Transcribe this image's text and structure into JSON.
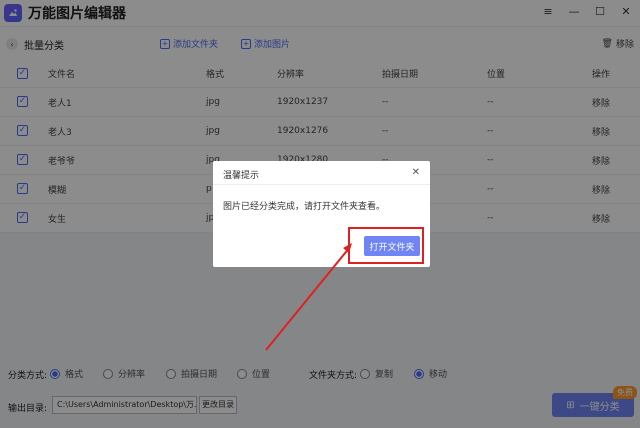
{
  "app": {
    "title": "万能图片编辑器"
  },
  "toolbar": {
    "page_title": "批量分类",
    "add_folder": "添加文件夹",
    "add_image": "添加图片",
    "remove": "移除"
  },
  "table": {
    "headers": [
      "文件名",
      "格式",
      "分辨率",
      "拍摄日期",
      "位置",
      "操作"
    ],
    "rows": [
      {
        "name": "老人1",
        "format": "jpg",
        "resolution": "1920x1237",
        "date": "--",
        "location": "--",
        "action": "移除"
      },
      {
        "name": "老人3",
        "format": "jpg",
        "resolution": "1920x1276",
        "date": "--",
        "location": "--",
        "action": "移除"
      },
      {
        "name": "老爷爷",
        "format": "jpg",
        "resolution": "1920x1280",
        "date": "--",
        "location": "--",
        "action": "移除"
      },
      {
        "name": "模糊",
        "format": "p",
        "resolution": "",
        "date": "--",
        "location": "--",
        "action": "移除"
      },
      {
        "name": "女生",
        "format": "jp",
        "resolution": "",
        "date": "--",
        "location": "--",
        "action": "移除"
      }
    ]
  },
  "bottom": {
    "classify_label": "分类方式:",
    "classify_options": [
      "格式",
      "分辨率",
      "拍摄日期",
      "位置"
    ],
    "folder_label": "文件夹方式:",
    "folder_options": [
      "复制",
      "移动"
    ],
    "output_label": "输出目录:",
    "output_path": "C:\\Users\\Administrator\\Desktop\\万...",
    "change_dir": "更改目录",
    "classify_button": "一键分类",
    "free_badge": "免费"
  },
  "dialog": {
    "title": "温馨提示",
    "message": "图片已经分类完成，请打开文件夹查看。",
    "button": "打开文件夹"
  },
  "colors": {
    "accent": "#6f84f5",
    "highlight": "#e02020",
    "badge": "#ff9a2e"
  }
}
